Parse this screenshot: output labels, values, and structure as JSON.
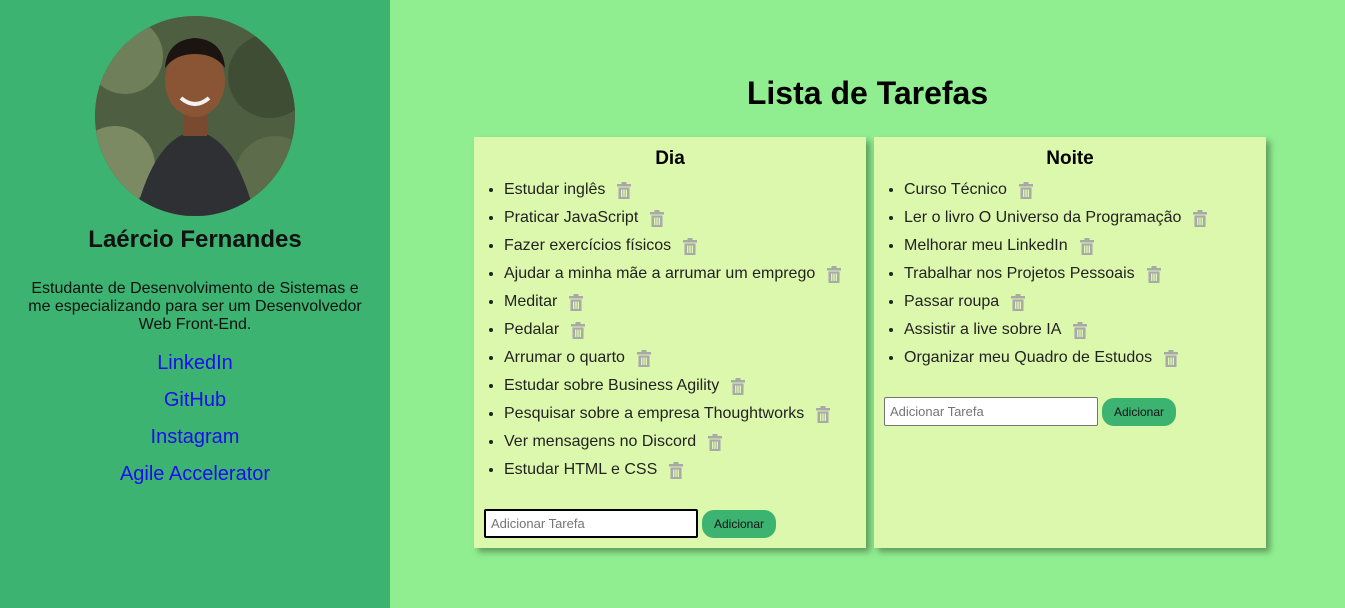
{
  "profile": {
    "name": "Laércio Fernandes",
    "bio": "Estudante de Desenvolvimento de Sistemas e me especializando para ser um Desenvolvedor Web Front-End.",
    "links": [
      "LinkedIn",
      "GitHub",
      "Instagram",
      "Agile Accelerator"
    ]
  },
  "page_title": "Lista de Tarefas",
  "colors": {
    "sidebar": "#3cb371",
    "background": "#90ee90",
    "panel": "#dcf8ac",
    "link": "#1a0dee",
    "button": "#3cb371",
    "trash_icon": "#a9a9a9"
  },
  "lists": {
    "dia": {
      "title": "Dia",
      "items": [
        "Estudar inglês",
        "Praticar JavaScript",
        "Fazer exercícios físicos",
        "Ajudar a minha mãe a arrumar um emprego",
        "Meditar",
        "Pedalar",
        "Arrumar o quarto",
        "Estudar sobre Business Agility",
        "Pesquisar sobre a empresa Thoughtworks",
        "Ver mensagens no Discord",
        "Estudar HTML e CSS"
      ],
      "input_placeholder": "Adicionar Tarefa",
      "button_label": "Adicionar"
    },
    "noite": {
      "title": "Noite",
      "items": [
        "Curso Técnico",
        "Ler o livro O Universo da Programação",
        "Melhorar meu LinkedIn",
        "Trabalhar nos Projetos Pessoais",
        "Passar roupa",
        "Assistir a live sobre IA",
        "Organizar meu Quadro de Estudos"
      ],
      "input_placeholder": "Adicionar Tarefa",
      "button_label": "Adicionar"
    }
  }
}
